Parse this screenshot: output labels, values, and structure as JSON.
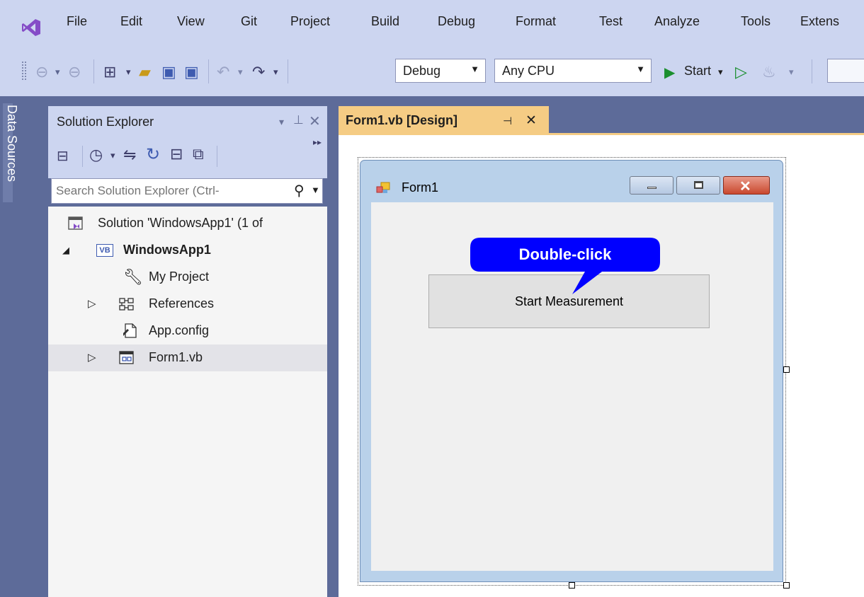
{
  "menu": {
    "items": [
      "File",
      "Edit",
      "View",
      "Git",
      "Project",
      "Build",
      "Debug",
      "Format",
      "Test",
      "Analyze",
      "Tools",
      "Extens"
    ]
  },
  "toolbar": {
    "configuration": "Debug",
    "platform": "Any CPU",
    "start_label": "Start"
  },
  "side_tabs": {
    "data_sources": "Data Sources"
  },
  "solution_explorer": {
    "title": "Solution Explorer",
    "search_placeholder": "Search Solution Explorer (Ctrl-",
    "tree": [
      {
        "label": "Solution 'WindowsApp1' (1 of"
      },
      {
        "label": "WindowsApp1",
        "badge": "VB"
      },
      {
        "label": "My Project"
      },
      {
        "label": "References"
      },
      {
        "label": "App.config"
      },
      {
        "label": "Form1.vb"
      }
    ]
  },
  "document_tab": {
    "title": "Form1.vb [Design]"
  },
  "form": {
    "title": "Form1",
    "button_label": "Start Measurement"
  },
  "callout": {
    "text": "Double-click"
  },
  "colors": {
    "menubar_bg": "#CCD5F0",
    "frame_dark": "#5D6B99",
    "tab_active": "#F5CC84",
    "callout_blue": "#0000FF",
    "play_green": "#1B8F2F",
    "vs_purple": "#854CC7"
  }
}
